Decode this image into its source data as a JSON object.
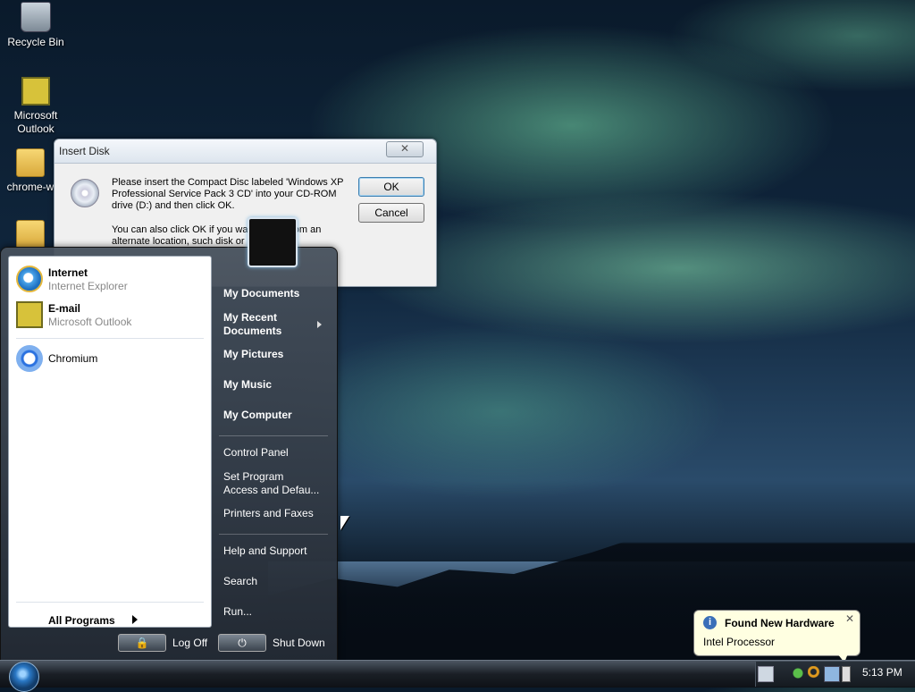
{
  "desktop": {
    "icons": [
      {
        "label": "Recycle Bin",
        "icon": "recycle-bin-icon"
      },
      {
        "label": "Microsoft\nOutlook",
        "icon": "outlook-icon"
      },
      {
        "label": "chrome-w",
        "icon": "folder-icon"
      },
      {
        "label": "",
        "icon": "folder-icon"
      }
    ]
  },
  "dialog": {
    "title": "Insert Disk",
    "close_label": "✕",
    "message": "Please insert the Compact Disc labeled 'Windows XP Professional Service Pack 3 CD' into your CD-ROM drive (D:) and then click OK.",
    "message2": "You can also click OK if you wan  copied from an alternate location, such  disk or a",
    "ok_label": "OK",
    "cancel_label": "Cancel",
    "icon": "cd-drive-icon"
  },
  "start_menu": {
    "pinned": [
      {
        "title": "Internet",
        "subtitle": "Internet Explorer",
        "icon": "internet-explorer-icon"
      },
      {
        "title": "E-mail",
        "subtitle": "Microsoft Outlook",
        "icon": "outlook-icon"
      }
    ],
    "recent": [
      {
        "title": "Chromium",
        "icon": "chromium-icon"
      }
    ],
    "all_programs": "All Programs",
    "right_items": {
      "my_documents": "My Documents",
      "my_recent_documents": "My Recent Documents",
      "my_pictures": "My Pictures",
      "my_music": "My Music",
      "my_computer": "My Computer",
      "control_panel": "Control Panel",
      "set_program_access": "Set Program Access and Defau...",
      "printers_faxes": "Printers and Faxes",
      "help_support": "Help and Support",
      "search": "Search",
      "run": "Run..."
    },
    "log_off": "Log Off",
    "shut_down": "Shut Down"
  },
  "notification": {
    "title": "Found New Hardware",
    "text": "Intel Processor",
    "close_label": "✕",
    "icon": "info-icon"
  },
  "taskbar": {
    "clock": "5:13 PM",
    "tray_icons": [
      "keyboard-icon",
      "network-icon",
      "search-icon",
      "monitor-icon",
      "safely-remove-icon"
    ]
  },
  "colors": {
    "aurora": "#6fd1a8",
    "taskbar": "#1a1f26",
    "balloon": "#ffffe1"
  }
}
